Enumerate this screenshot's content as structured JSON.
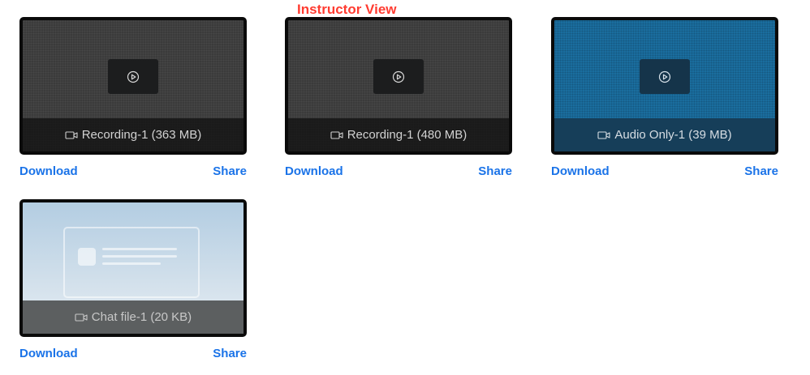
{
  "header": {
    "title": "Instructor View"
  },
  "colors": {
    "header_text": "#ff3b30",
    "link": "#1a73e8",
    "card_border": "#0a0a0a",
    "dark_thumb": "#3b3b3b",
    "blue_thumb": "#1a6d9e",
    "chat_thumb": "#b3cde2"
  },
  "icons": {
    "play": "play-circle-icon",
    "camera": "video-camera-icon"
  },
  "recordings": [
    {
      "caption": "Recording-1 (363 MB)",
      "download_label": "Download",
      "share_label": "Share"
    },
    {
      "caption": "Recording-1 (480 MB)",
      "download_label": "Download",
      "share_label": "Share"
    },
    {
      "caption": "Audio Only-1 (39 MB)",
      "download_label": "Download",
      "share_label": "Share"
    },
    {
      "caption": "Chat file-1 (20 KB)",
      "download_label": "Download",
      "share_label": "Share"
    }
  ]
}
